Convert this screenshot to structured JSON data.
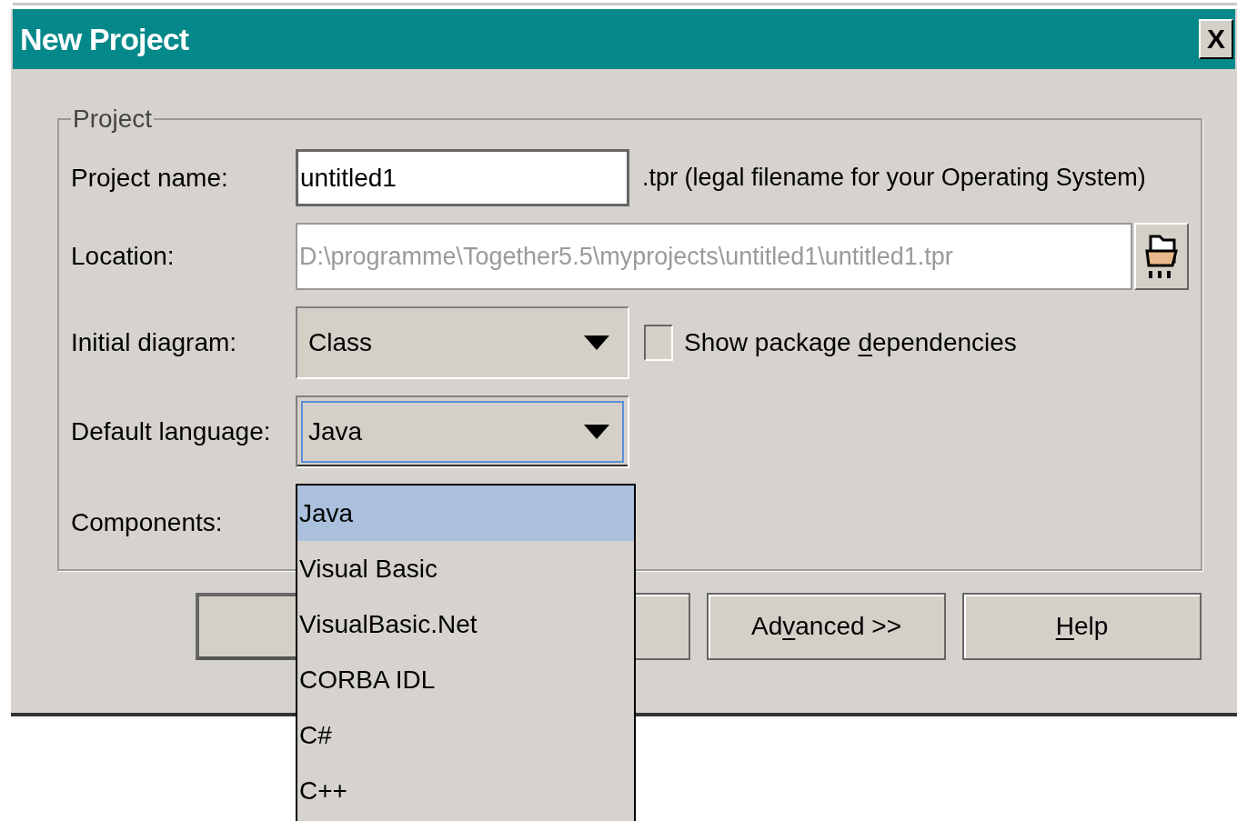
{
  "window": {
    "title": "New Project",
    "close_label": "X"
  },
  "group": {
    "title": "Project"
  },
  "project_name": {
    "label": "Project name:",
    "value": "untitled1",
    "suffix": ".tpr (legal filename for your Operating System)"
  },
  "location": {
    "label": "Location:",
    "value": "D:\\programme\\Together5.5\\myprojects\\untitled1\\untitled1.tpr",
    "disabled": true
  },
  "initial_diagram": {
    "label": "Initial diagram:",
    "value": "Class",
    "focused": false
  },
  "show_dependencies": {
    "label_parts": [
      {
        "text": "Show package ",
        "underlined": false
      },
      {
        "text": "d",
        "underlined": true
      },
      {
        "text": "ependencies",
        "underlined": false
      }
    ],
    "checked": false
  },
  "default_language": {
    "label": "Default language:",
    "value": "Java",
    "focused": true,
    "expanded": true
  },
  "components": {
    "label": "Components:"
  },
  "language_options": [
    {
      "label": "Java",
      "selected": true
    },
    {
      "label": "Visual Basic",
      "selected": false
    },
    {
      "label": "VisualBasic.Net",
      "selected": false
    },
    {
      "label": "CORBA IDL",
      "selected": false
    },
    {
      "label": "C#",
      "selected": false
    },
    {
      "label": "C++",
      "selected": false
    }
  ],
  "buttons": [
    {
      "kind": "covered",
      "default": true
    },
    {
      "kind": "covered",
      "default": false
    },
    {
      "kind": "labeled",
      "label_parts": [
        {
          "text": "Ad",
          "underlined": false
        },
        {
          "text": "v",
          "underlined": true
        },
        {
          "text": "anced >>",
          "underlined": false
        }
      ],
      "default": false
    },
    {
      "kind": "labeled",
      "label_parts": [
        {
          "text": "H",
          "underlined": true
        },
        {
          "text": "elp",
          "underlined": false
        }
      ],
      "default": false
    }
  ]
}
